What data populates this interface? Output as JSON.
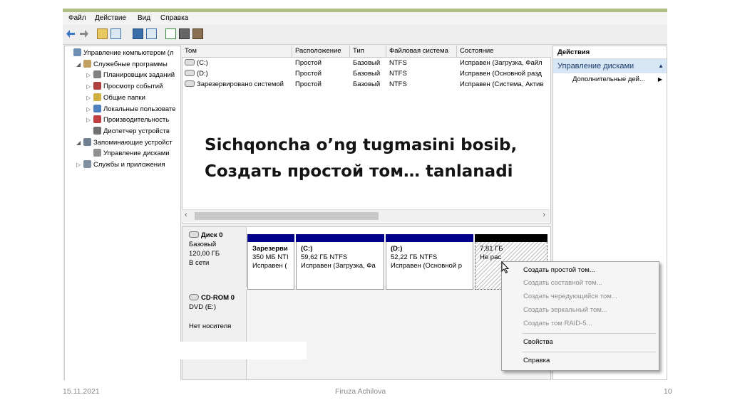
{
  "menu": [
    "Файл",
    "Действие",
    "Вид",
    "Справка"
  ],
  "tree": [
    {
      "label": "Управление компьютером (л",
      "depth": 0,
      "arrow": "",
      "icon": "computer-icon",
      "color": "#6f8fb5"
    },
    {
      "label": "Служебные программы",
      "depth": 1,
      "arrow": "◢",
      "icon": "tools-icon",
      "color": "#c0a060"
    },
    {
      "label": "Планировщик заданий",
      "depth": 2,
      "arrow": "▷",
      "icon": "clock-icon",
      "color": "#808080"
    },
    {
      "label": "Просмотр событий",
      "depth": 2,
      "arrow": "▷",
      "icon": "event-viewer-icon",
      "color": "#b04040"
    },
    {
      "label": "Общие папки",
      "depth": 2,
      "arrow": "▷",
      "icon": "shared-folder-icon",
      "color": "#d0b040"
    },
    {
      "label": "Локальные пользовате",
      "depth": 2,
      "arrow": "▷",
      "icon": "users-icon",
      "color": "#5080c0"
    },
    {
      "label": "Производительность",
      "depth": 2,
      "arrow": "▷",
      "icon": "performance-icon",
      "color": "#c04040"
    },
    {
      "label": "Диспетчер устройств",
      "depth": 2,
      "arrow": "",
      "icon": "device-manager-icon",
      "color": "#707070"
    },
    {
      "label": "Запоминающие устройст",
      "depth": 1,
      "arrow": "◢",
      "icon": "storage-icon",
      "color": "#708090"
    },
    {
      "label": "Управление дисками",
      "depth": 2,
      "arrow": "",
      "icon": "disk-management-icon",
      "color": "#909090"
    },
    {
      "label": "Службы и приложения",
      "depth": 1,
      "arrow": "▷",
      "icon": "services-icon",
      "color": "#8090a0"
    }
  ],
  "volumes": {
    "columns": [
      "Том",
      "Расположение",
      "Тип",
      "Файловая система",
      "Состояние"
    ],
    "rows": [
      [
        "(C:)",
        "Простой",
        "Базовый",
        "NTFS",
        "Исправен (Загрузка, Файл"
      ],
      [
        "(D:)",
        "Простой",
        "Базовый",
        "NTFS",
        "Исправен (Основной разд"
      ],
      [
        "Зарезервировано системой",
        "Простой",
        "Базовый",
        "NTFS",
        "Исправен (Система, Актив"
      ]
    ]
  },
  "disks": {
    "disk0": {
      "name": "Диск 0",
      "type": "Базовый",
      "size": "120,00 ГБ",
      "status": "В сети"
    },
    "cdrom": {
      "name": "CD-ROM 0",
      "drive": "DVD (E:)",
      "media": "Нет носителя"
    }
  },
  "partitions": [
    {
      "title": "Зарезерви",
      "size": "350 МБ NTI",
      "status": "Исправен ("
    },
    {
      "title": "(C:)",
      "size": "59,62 ГБ NTFS",
      "status": "Исправен (Загрузка, Фа"
    },
    {
      "title": "(D:)",
      "size": "52,22 ГБ NTFS",
      "status": "Исправен (Основной р"
    },
    {
      "title": "",
      "size": "7,81 ГБ",
      "status": "Не рас"
    }
  ],
  "actions": {
    "header": "Действия",
    "section": "Управление дисками",
    "more": "Дополнительные дей..."
  },
  "context_menu": [
    {
      "label": "Создать простой том...",
      "enabled": true
    },
    {
      "label": "Создать составной том...",
      "enabled": false
    },
    {
      "label": "Создать чередующийся том...",
      "enabled": false
    },
    {
      "label": "Создать зеркальный том...",
      "enabled": false
    },
    {
      "label": "Создать том RAID-5...",
      "enabled": false
    },
    {
      "label": "Свойства",
      "enabled": true
    },
    {
      "label": "Справка",
      "enabled": true
    }
  ],
  "overlay": {
    "line1": "Sichqoncha o’ng tugmasini bosib,",
    "line2": "Создать простой том… tanlanadi"
  },
  "footer": {
    "date": "15.11.2021",
    "author": "Firuza Achilova",
    "page": "10"
  },
  "colors": {
    "primary_partition": "#00008b",
    "unallocated": "#000000",
    "actions_highlight": "#d6e6f5",
    "frame_accent": "#aabf80"
  }
}
